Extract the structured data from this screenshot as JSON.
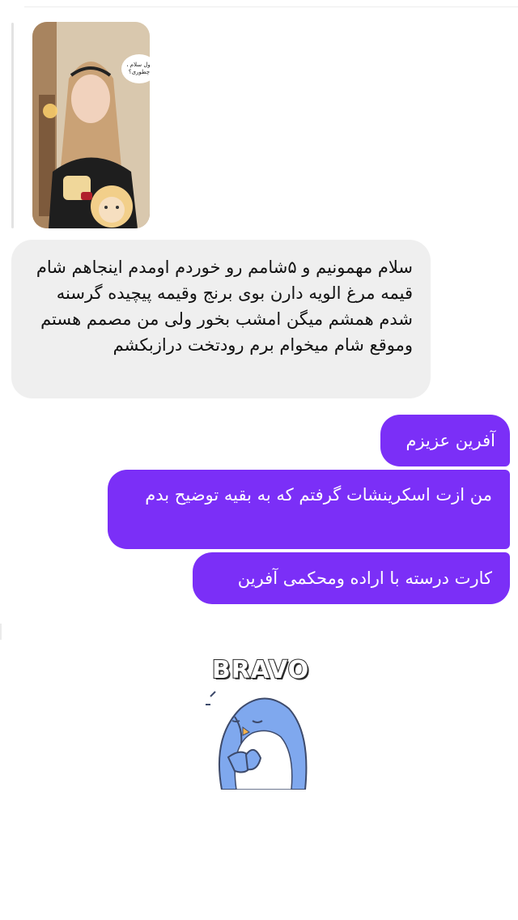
{
  "story": {
    "sticker_text": "اول سلام ،\nچطوری؟",
    "image_icon": "story-photo"
  },
  "messages": {
    "incoming": {
      "text": "سلام مهمونیم و ۵شامم رو خوردم اومدم اینجاهم شام قیمه مرغ الویه دارن بوی برنج وقیمه پیچیده گرسنه شدم همشم میگن امشب بخور ولی من مصمم هستم وموقع شام میخوام برم رودتخت درازبکشم"
    },
    "outgoing": [
      {
        "text": "آفرین عزیزم"
      },
      {
        "text": "من ازت اسکرینشات گرفتم که به بقیه توضیح بدم"
      },
      {
        "text": "کارت درسته با اراده ومحکمی آفرین"
      }
    ]
  },
  "sticker": {
    "word": "BRAVO",
    "icon": "penguin-sticker",
    "colors": {
      "body": "#7fa8ee",
      "belly": "#ffffff",
      "beak": "#f6b24a"
    }
  },
  "colors": {
    "outgoing_bubble": "#7b2ff7",
    "incoming_bubble": "#efefef"
  }
}
